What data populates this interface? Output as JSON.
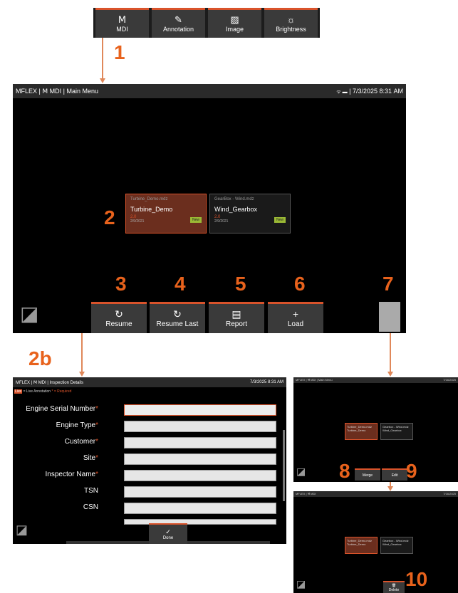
{
  "toolbar": {
    "buttons": [
      {
        "label": "MDI",
        "icon": "Ⅿ"
      },
      {
        "label": "Annotation",
        "icon": "✎"
      },
      {
        "label": "Image",
        "icon": "▨"
      },
      {
        "label": "Brightness",
        "icon": "☼"
      }
    ]
  },
  "callouts": {
    "c1": "1",
    "c2": "2",
    "c2b": "2b",
    "c3": "3",
    "c4": "4",
    "c5": "5",
    "c6": "6",
    "c7": "7",
    "c8": "8",
    "c9": "9",
    "c10": "10"
  },
  "main_screen": {
    "title": "MFLEX | Ⅿ MDI | Main Menu",
    "datetime": "7/3/2025  8:31 AM",
    "status_icons": "ᯤ ▬",
    "cards": [
      {
        "file": "Turbine_Demo.mdz",
        "name": "Turbine_Demo",
        "version": "2.0",
        "date": "2/9/2021",
        "badge": "New"
      },
      {
        "file": "GearBox - Wind.mdz",
        "name": "Wind_Gearbox",
        "version": "2.0",
        "date": "2/9/2021",
        "badge": "New"
      }
    ],
    "buttons": [
      {
        "label": "Resume",
        "icon": "↻"
      },
      {
        "label": "Resume Last",
        "icon": "↻"
      },
      {
        "label": "Report",
        "icon": "▤"
      },
      {
        "label": "Load",
        "icon": "+"
      }
    ]
  },
  "inspection": {
    "title": "MFLEX | Ⅿ MDI | Inspection Details",
    "datetime": "7/3/2025  8:31 AM",
    "legend_live": "Live",
    "legend_text": " = Live Annotation  ",
    "legend_req": "* = Required",
    "fields": [
      {
        "label": "Engine Serial Number",
        "required": "*"
      },
      {
        "label": "Engine Type",
        "required": "*"
      },
      {
        "label": "Customer",
        "required": "*"
      },
      {
        "label": "Site",
        "required": "*"
      },
      {
        "label": "Inspector Name",
        "required": "*"
      },
      {
        "label": "TSN",
        "required": ""
      },
      {
        "label": "CSN",
        "required": ""
      }
    ],
    "done_label": "Done",
    "done_icon": "✓"
  },
  "mini_screen_1": {
    "title": "MFLEX | Ⅿ MDI | Main Menu",
    "datetime": "7/16/2025",
    "cards": [
      {
        "file": "Turbine_Demo.mdz",
        "name": "Turbine_Demo"
      },
      {
        "file": "Gearbox - Wind.mdz",
        "name": "Wind_Gearbox"
      }
    ],
    "buttons": [
      "Merge",
      "Edit"
    ]
  },
  "mini_screen_2": {
    "title": "MFLEX | Ⅿ MDI",
    "datetime": "7/16/2025",
    "cards": [
      {
        "file": "Turbine_Demo.mdz",
        "name": "Turbine_Demo"
      },
      {
        "file": "Gearbox - Wind.mdz",
        "name": "Wind_Gearbox"
      }
    ],
    "delete_label": "Delete",
    "delete_icon": "🗑"
  },
  "colors": {
    "accent": "#d9532b",
    "callout": "#e8621c",
    "badge": "#9bb935"
  }
}
